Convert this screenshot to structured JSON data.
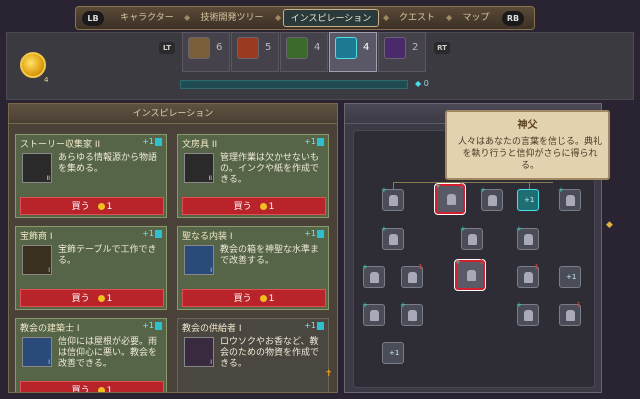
{
  "top_nav": {
    "lb": "LB",
    "rb": "RB",
    "tabs": [
      {
        "label": "キャラクター"
      },
      {
        "label": "技術開発ツリー"
      },
      {
        "label": "インスピレーション"
      },
      {
        "label": "クエスト"
      },
      {
        "label": "マップ"
      }
    ],
    "active_tab": "インスピレーション"
  },
  "header": {
    "coin_count": "4",
    "lt": "LT",
    "rt": "RT",
    "categories": [
      {
        "icon": "hammer-icon",
        "count": "6"
      },
      {
        "icon": "gear-icon",
        "count": "5"
      },
      {
        "icon": "scroll-icon",
        "count": "4"
      },
      {
        "icon": "book-icon",
        "count": "4"
      },
      {
        "icon": "skull-icon",
        "count": "2"
      }
    ],
    "progress_value": "0",
    "progress_fraction": 0
  },
  "left_panel": {
    "title": "インスピレーション",
    "cards": [
      {
        "title": "ストーリー収集家 II",
        "plus": "+1",
        "desc": "あらゆる情報源から物語を集める。",
        "level": "II",
        "buy": "買う",
        "cost": "1",
        "icon": "book-page-icon"
      },
      {
        "title": "文房具 II",
        "plus": "+1",
        "desc": "管理作業は欠かせないもの。インクや紙を作成できる。",
        "level": "II",
        "buy": "買う",
        "cost": "1",
        "icon": "ink-bottle-icon"
      },
      {
        "title": "宝飾商 I",
        "plus": "+1",
        "desc": "宝飾テーブルで工作できる。",
        "level": "I",
        "buy": "買う",
        "cost": "1",
        "icon": "ring-icon"
      },
      {
        "title": "聖なる内装 I",
        "plus": "+1",
        "desc": "教会の箱を神聖な水準まで改善する。",
        "level": "I",
        "buy": "買う",
        "cost": "1",
        "icon": "chapel-interior-icon"
      },
      {
        "title": "教会の建築士 I",
        "plus": "+1",
        "desc": "信仰には屋根が必要。雨は信仰心に悪い。教会を改善できる。",
        "level": "I",
        "buy": "買う",
        "cost": "1",
        "icon": "church-icon"
      },
      {
        "title": "教会の供給者 I",
        "plus": "+1",
        "desc": "ロウソクやお香など、教会のための物資を作成できる。",
        "level": "I",
        "buy": "買う",
        "cost": "1",
        "icon": "incense-icon"
      }
    ]
  },
  "tooltip": {
    "title": "神父",
    "body": "人々はあなたの言葉を信じる。典礼を執り行うと信仰がさらに得られる。"
  },
  "tree": {
    "plus_label": "+1"
  },
  "colors": {
    "accent_cyan": "#2ec0d0",
    "buy_red": "#b8242a",
    "card_green": "#566548",
    "highlight_red": "#d02030"
  }
}
